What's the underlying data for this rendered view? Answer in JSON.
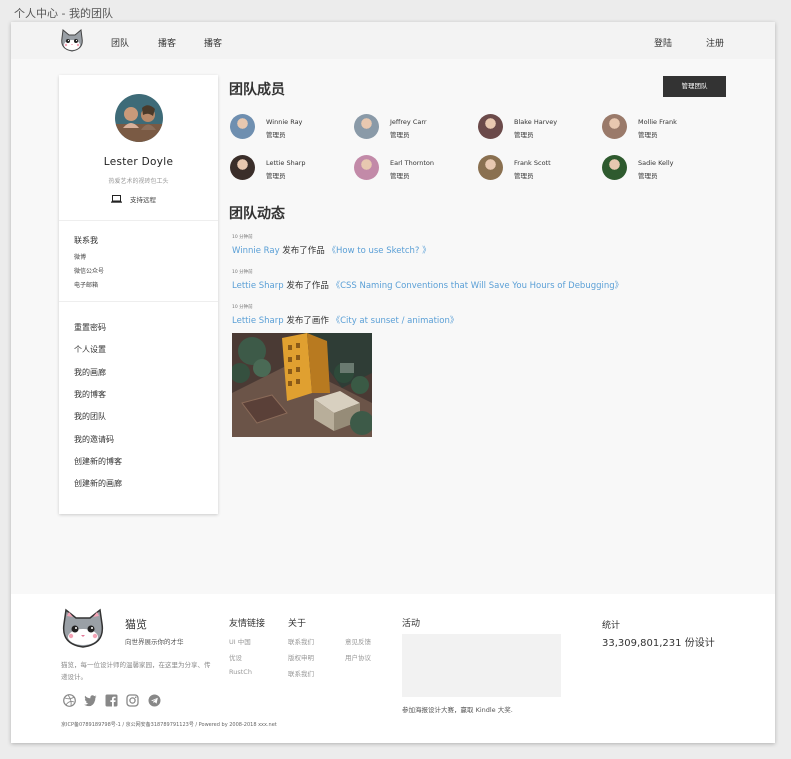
{
  "window": {
    "title": "个人中心 - 我的团队"
  },
  "nav": {
    "links": [
      "团队",
      "播客",
      "播客"
    ],
    "login": "登陆",
    "register": "注册"
  },
  "profile": {
    "name": "Lester Doyle",
    "bio": "热爱艺术的视砖包工头",
    "remote_label": "支持远程",
    "contact_title": "联系我",
    "contacts": [
      "微博",
      "微信公众号",
      "电子邮箱"
    ],
    "menu": [
      "重置密码",
      "个人设置",
      "我的画廊",
      "我的博客",
      "我的团队",
      "我的邀请码",
      "创建新的博客",
      "创建新的画廊"
    ]
  },
  "team": {
    "title": "团队成员",
    "manage_button": "管理团队",
    "members": [
      {
        "name": "Winnie Ray",
        "role": "管理员",
        "color": "#6f8fb0"
      },
      {
        "name": "Jeffrey Carr",
        "role": "管理员",
        "color": "#8a9aa8"
      },
      {
        "name": "Blake Harvey",
        "role": "管理员",
        "color": "#6b4a4a"
      },
      {
        "name": "Mollie Frank",
        "role": "管理员",
        "color": "#9a7a6a"
      },
      {
        "name": "Lettie Sharp",
        "role": "管理员",
        "color": "#3a2e2a"
      },
      {
        "name": "Earl Thornton",
        "role": "管理员",
        "color": "#c28aa8"
      },
      {
        "name": "Frank Scott",
        "role": "管理员",
        "color": "#8a7050"
      },
      {
        "name": "Sadie Kelly",
        "role": "管理员",
        "color": "#2e5a2e"
      }
    ]
  },
  "activity": {
    "title": "团队动态",
    "items": [
      {
        "time": "10 分钟前",
        "user": "Winnie Ray",
        "action": " 发布了作品 ",
        "work": "《How to use Sketch? 》"
      },
      {
        "time": "10 分钟前",
        "user": "Lettie Sharp",
        "action": " 发布了作品 ",
        "work": "《CSS Naming Conventions that Will Save You Hours of Debugging》"
      },
      {
        "time": "10 分钟前",
        "user": "Lettie Sharp",
        "action": " 发布了画作 ",
        "work": "《City at sunset / animation》"
      }
    ]
  },
  "footer": {
    "brand": "猫览",
    "slogan": "向世界展示你的才华",
    "desc": "猫览，每一位设计师的温馨家园，在这里为分享、传递设计。",
    "friends_title": "友情链接",
    "friends": [
      "UI 中国",
      "优设",
      "RustCh"
    ],
    "about_title": "关于",
    "about_col1": [
      "联系我们",
      "版权申明",
      "联系我们"
    ],
    "about_col2": [
      "意见反馈",
      "用户协议"
    ],
    "activity_title": "活动",
    "activity_text": "参加海报设计大赛，赢取 Kindle 大奖.",
    "stats_title": "统计",
    "stats_value": "33,309,801,231 份设计",
    "icp": "京ICP备0789189798号-1 / 京公网安备318789791123号 / Powered by 2008-2018 xxx.net",
    "social_icons": [
      "dribbble-icon",
      "twitter-icon",
      "facebook-icon",
      "instagram-icon",
      "telegram-icon"
    ]
  },
  "colors": {
    "link": "#5a9fd6",
    "dark_button": "#333333"
  }
}
